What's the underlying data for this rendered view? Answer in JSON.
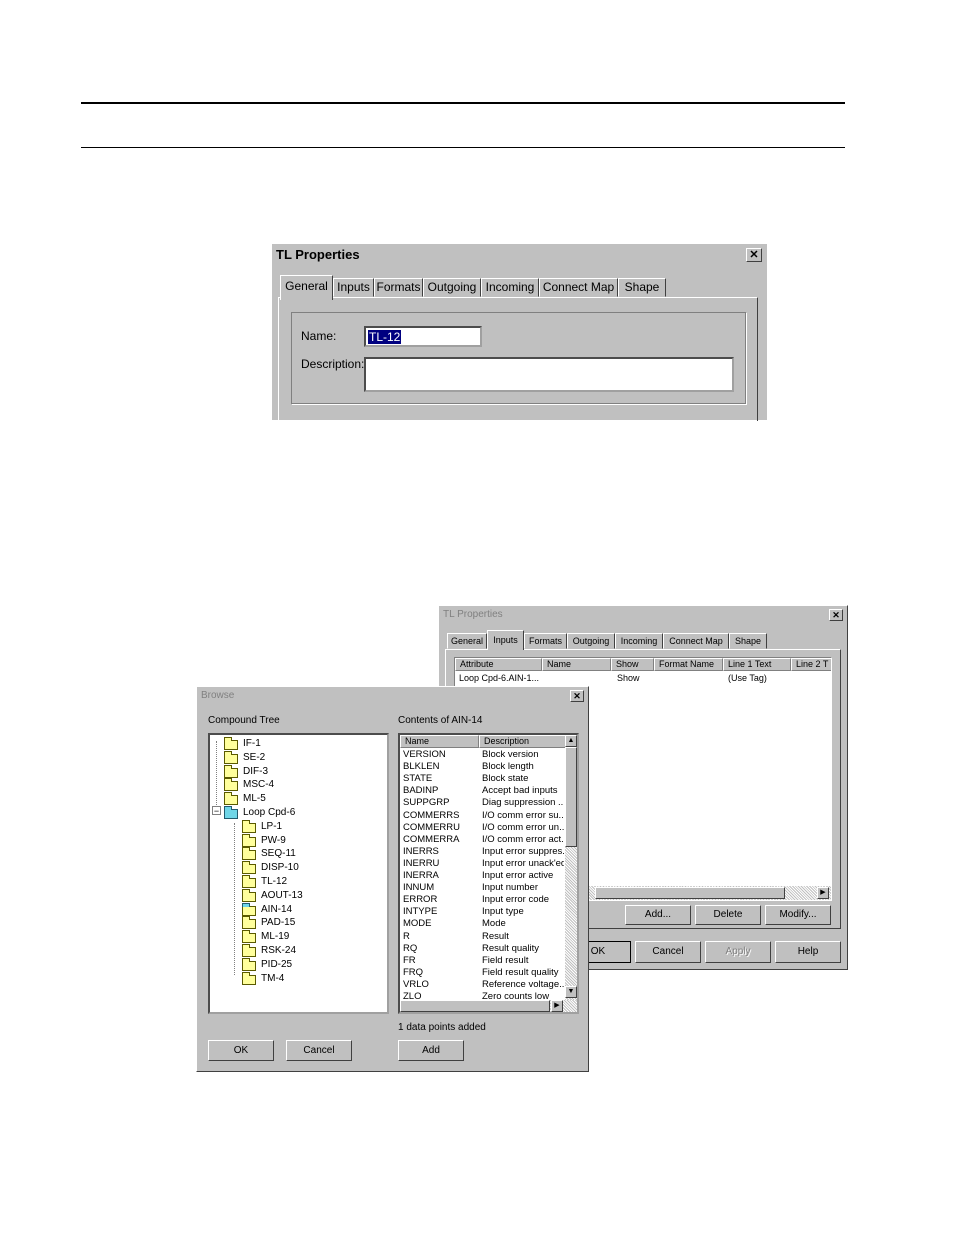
{
  "dialog1": {
    "title": "TL Properties",
    "tabs": [
      "General",
      "Inputs",
      "Formats",
      "Outgoing",
      "Incoming",
      "Connect Map",
      "Shape"
    ],
    "name_label": "Name:",
    "name_value": "TL-12",
    "description_label": "Description:",
    "description_value": ""
  },
  "dialog2": {
    "title": "TL Properties",
    "tabs": [
      "General",
      "Inputs",
      "Formats",
      "Outgoing",
      "Incoming",
      "Connect Map",
      "Shape"
    ],
    "columns": [
      "Attribute",
      "Name",
      "Show",
      "Format Name",
      "Line 1 Text",
      "Line 2 T"
    ],
    "rows": [
      {
        "attribute": "Loop Cpd-6.AIN-1...",
        "name": "",
        "show": "Show",
        "format": "",
        "line1": "(Use Tag)",
        "line2": ""
      }
    ],
    "buttons": {
      "add": "Add...",
      "delete": "Delete",
      "modify": "Modify...",
      "ok": "OK",
      "cancel": "Cancel",
      "apply": "Apply",
      "help": "Help"
    }
  },
  "browse": {
    "title": "Browse",
    "tree_label": "Compound Tree",
    "contents_label": "Contents of AIN-14",
    "tree_items": [
      {
        "label": "IF-1",
        "level": 0
      },
      {
        "label": "SE-2",
        "level": 0
      },
      {
        "label": "DIF-3",
        "level": 0
      },
      {
        "label": "MSC-4",
        "level": 0
      },
      {
        "label": "ML-5",
        "level": 0
      },
      {
        "label": "Loop Cpd-6",
        "level": 0,
        "expanded": true
      },
      {
        "label": "LP-1",
        "level": 1
      },
      {
        "label": "PW-9",
        "level": 1
      },
      {
        "label": "SEQ-11",
        "level": 1
      },
      {
        "label": "DISP-10",
        "level": 1
      },
      {
        "label": "TL-12",
        "level": 1
      },
      {
        "label": "AOUT-13",
        "level": 1
      },
      {
        "label": "AIN-14",
        "level": 1,
        "selected": true
      },
      {
        "label": "PAD-15",
        "level": 1
      },
      {
        "label": "ML-19",
        "level": 1
      },
      {
        "label": "RSK-24",
        "level": 1
      },
      {
        "label": "PID-25",
        "level": 1
      },
      {
        "label": "TM-4",
        "level": 1
      }
    ],
    "list_columns": [
      "Name",
      "Description"
    ],
    "list_rows": [
      [
        "VERSION",
        "Block version"
      ],
      [
        "BLKLEN",
        "Block length"
      ],
      [
        "STATE",
        "Block state"
      ],
      [
        "BADINP",
        "Accept bad inputs"
      ],
      [
        "SUPPGRP",
        "Diag suppression ..."
      ],
      [
        "COMMERRS",
        "I/O comm error su..."
      ],
      [
        "COMMERRU",
        "I/O comm error un..."
      ],
      [
        "COMMERRA",
        "I/O comm error act..."
      ],
      [
        "INERRS",
        "Input error suppres..."
      ],
      [
        "INERRU",
        "Input error unack'ed"
      ],
      [
        "INERRA",
        "Input error active"
      ],
      [
        "INNUM",
        "Input number"
      ],
      [
        "ERROR",
        "Input error code"
      ],
      [
        "INTYPE",
        "Input type"
      ],
      [
        "MODE",
        "Mode"
      ],
      [
        "R",
        "Result"
      ],
      [
        "RQ",
        "Result quality"
      ],
      [
        "FR",
        "Field result"
      ],
      [
        "FRQ",
        "Field result quality"
      ],
      [
        "VRLO",
        "Reference voltage..."
      ],
      [
        "ZLO",
        "Zero counts low"
      ]
    ],
    "status": "1 data points added",
    "buttons": {
      "ok": "OK",
      "cancel": "Cancel",
      "add": "Add"
    }
  }
}
